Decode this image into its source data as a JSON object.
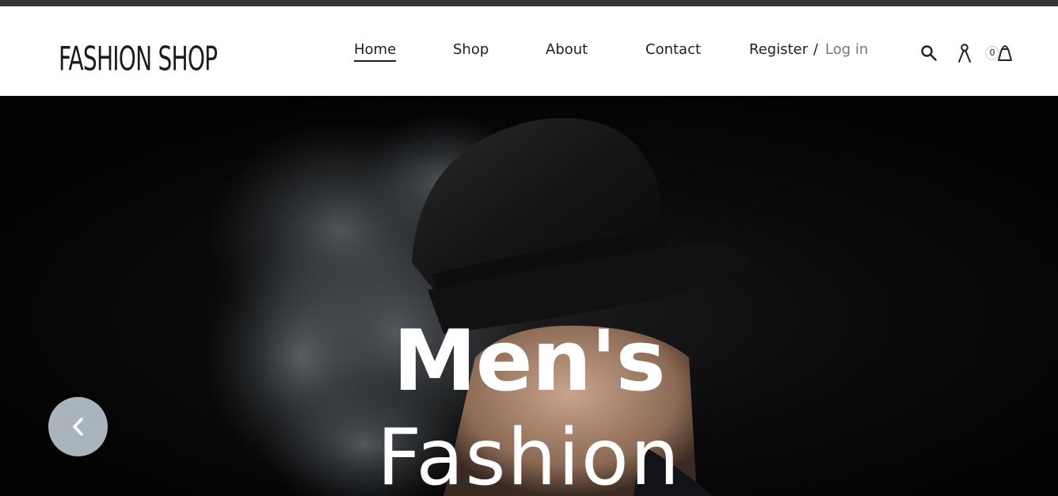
{
  "header": {
    "logo": "FASHION SHOP",
    "nav": {
      "home": "Home",
      "shop": "Shop",
      "about": "About",
      "contact": "Contact",
      "register": "Register",
      "separator": "/",
      "login": "Log in"
    },
    "icons": {
      "search": "search-icon",
      "account": "user-icon",
      "cart": "shopping-bag-icon"
    },
    "cart_count": "0"
  },
  "hero": {
    "title_line1": "Men's",
    "title_line2": "Fashion",
    "prev_icon": "chevron-left-icon"
  },
  "colors": {
    "topbar": "#333338",
    "text": "#1e1e1e",
    "login": "#777777",
    "hero_bg": "#030303",
    "prev_button": "#a9b4bd"
  }
}
